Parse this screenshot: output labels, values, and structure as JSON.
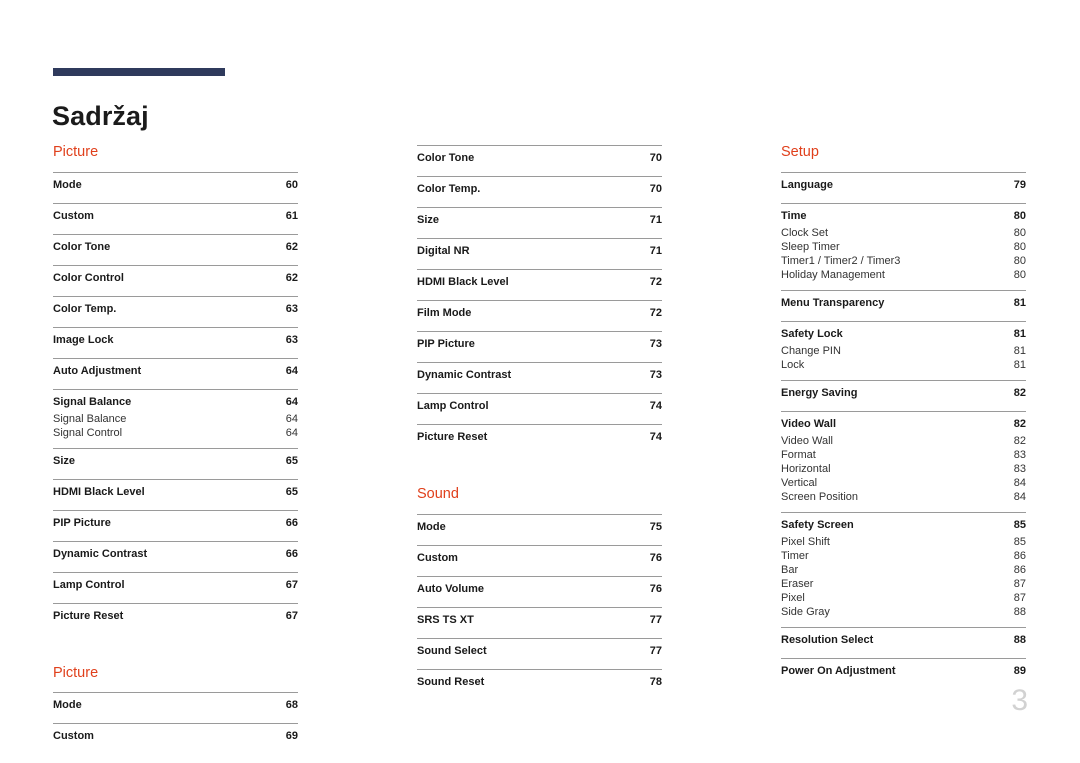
{
  "document": {
    "title": "Sadržaj",
    "folio": "3",
    "accent_color": "#e0401c",
    "rule_color": "#2f3a5c"
  },
  "columns": [
    {
      "id": "column-1",
      "sections": [
        {
          "heading": "Picture",
          "groups": [
            {
              "items": [
                {
                  "label": "Mode",
                  "page": "60"
                }
              ]
            },
            {
              "items": [
                {
                  "label": "Custom",
                  "page": "61"
                }
              ]
            },
            {
              "items": [
                {
                  "label": "Color Tone",
                  "page": "62"
                }
              ]
            },
            {
              "items": [
                {
                  "label": "Color Control",
                  "page": "62"
                }
              ]
            },
            {
              "items": [
                {
                  "label": "Color Temp.",
                  "page": "63"
                }
              ]
            },
            {
              "items": [
                {
                  "label": "Image Lock",
                  "page": "63"
                }
              ]
            },
            {
              "items": [
                {
                  "label": "Auto Adjustment",
                  "page": "64"
                }
              ]
            },
            {
              "items": [
                {
                  "label": "Signal Balance",
                  "page": "64"
                },
                {
                  "label": "Signal Balance",
                  "page": "64",
                  "sub": true
                },
                {
                  "label": "Signal Control",
                  "page": "64",
                  "sub": true
                }
              ]
            },
            {
              "items": [
                {
                  "label": "Size",
                  "page": "65"
                }
              ]
            },
            {
              "items": [
                {
                  "label": "HDMI Black Level",
                  "page": "65"
                }
              ]
            },
            {
              "items": [
                {
                  "label": "PIP Picture",
                  "page": "66"
                }
              ]
            },
            {
              "items": [
                {
                  "label": "Dynamic Contrast",
                  "page": "66"
                }
              ]
            },
            {
              "items": [
                {
                  "label": "Lamp Control",
                  "page": "67"
                }
              ]
            },
            {
              "items": [
                {
                  "label": "Picture Reset",
                  "page": "67"
                }
              ]
            }
          ]
        },
        {
          "heading": "Picture",
          "groups": [
            {
              "items": [
                {
                  "label": "Mode",
                  "page": "68"
                }
              ]
            },
            {
              "items": [
                {
                  "label": "Custom",
                  "page": "69"
                }
              ]
            }
          ]
        }
      ]
    },
    {
      "id": "column-2",
      "sections": [
        {
          "heading": "",
          "groups": [
            {
              "items": [
                {
                  "label": "Color Tone",
                  "page": "70"
                }
              ]
            },
            {
              "items": [
                {
                  "label": "Color Temp.",
                  "page": "70"
                }
              ]
            },
            {
              "items": [
                {
                  "label": "Size",
                  "page": "71"
                }
              ]
            },
            {
              "items": [
                {
                  "label": "Digital NR",
                  "page": "71"
                }
              ]
            },
            {
              "items": [
                {
                  "label": "HDMI Black Level",
                  "page": "72"
                }
              ]
            },
            {
              "items": [
                {
                  "label": "Film Mode",
                  "page": "72"
                }
              ]
            },
            {
              "items": [
                {
                  "label": "PIP Picture",
                  "page": "73"
                }
              ]
            },
            {
              "items": [
                {
                  "label": "Dynamic Contrast",
                  "page": "73"
                }
              ]
            },
            {
              "items": [
                {
                  "label": "Lamp Control",
                  "page": "74"
                }
              ]
            },
            {
              "items": [
                {
                  "label": "Picture Reset",
                  "page": "74"
                }
              ]
            }
          ]
        },
        {
          "heading": "Sound",
          "groups": [
            {
              "items": [
                {
                  "label": "Mode",
                  "page": "75"
                }
              ]
            },
            {
              "items": [
                {
                  "label": "Custom",
                  "page": "76"
                }
              ]
            },
            {
              "items": [
                {
                  "label": "Auto Volume",
                  "page": "76"
                }
              ]
            },
            {
              "items": [
                {
                  "label": "SRS TS XT",
                  "page": "77"
                }
              ]
            },
            {
              "items": [
                {
                  "label": "Sound Select",
                  "page": "77"
                }
              ]
            },
            {
              "items": [
                {
                  "label": "Sound Reset",
                  "page": "78"
                }
              ]
            }
          ]
        }
      ]
    },
    {
      "id": "column-3",
      "sections": [
        {
          "heading": "Setup",
          "groups": [
            {
              "items": [
                {
                  "label": "Language",
                  "page": "79"
                }
              ]
            },
            {
              "items": [
                {
                  "label": "Time",
                  "page": "80"
                },
                {
                  "label": "Clock Set",
                  "page": "80",
                  "sub": true
                },
                {
                  "label": "Sleep Timer",
                  "page": "80",
                  "sub": true
                },
                {
                  "label": "Timer1 / Timer2 / Timer3",
                  "page": "80",
                  "sub": true
                },
                {
                  "label": "Holiday Management",
                  "page": "80",
                  "sub": true
                }
              ]
            },
            {
              "items": [
                {
                  "label": "Menu Transparency",
                  "page": "81"
                }
              ]
            },
            {
              "items": [
                {
                  "label": "Safety Lock",
                  "page": "81"
                },
                {
                  "label": "Change PIN",
                  "page": "81",
                  "sub": true
                },
                {
                  "label": "Lock",
                  "page": "81",
                  "sub": true
                }
              ]
            },
            {
              "items": [
                {
                  "label": "Energy Saving",
                  "page": "82"
                }
              ]
            },
            {
              "items": [
                {
                  "label": "Video Wall",
                  "page": "82"
                },
                {
                  "label": "Video Wall",
                  "page": "82",
                  "sub": true
                },
                {
                  "label": "Format",
                  "page": "83",
                  "sub": true
                },
                {
                  "label": "Horizontal",
                  "page": "83",
                  "sub": true
                },
                {
                  "label": "Vertical",
                  "page": "84",
                  "sub": true
                },
                {
                  "label": "Screen Position",
                  "page": "84",
                  "sub": true
                }
              ]
            },
            {
              "items": [
                {
                  "label": "Safety Screen",
                  "page": "85"
                },
                {
                  "label": "Pixel Shift",
                  "page": "85",
                  "sub": true
                },
                {
                  "label": "Timer",
                  "page": "86",
                  "sub": true
                },
                {
                  "label": "Bar",
                  "page": "86",
                  "sub": true
                },
                {
                  "label": "Eraser",
                  "page": "87",
                  "sub": true
                },
                {
                  "label": "Pixel",
                  "page": "87",
                  "sub": true
                },
                {
                  "label": "Side Gray",
                  "page": "88",
                  "sub": true
                }
              ]
            },
            {
              "items": [
                {
                  "label": "Resolution Select",
                  "page": "88"
                }
              ]
            },
            {
              "items": [
                {
                  "label": "Power On Adjustment",
                  "page": "89"
                }
              ]
            }
          ]
        }
      ]
    }
  ]
}
